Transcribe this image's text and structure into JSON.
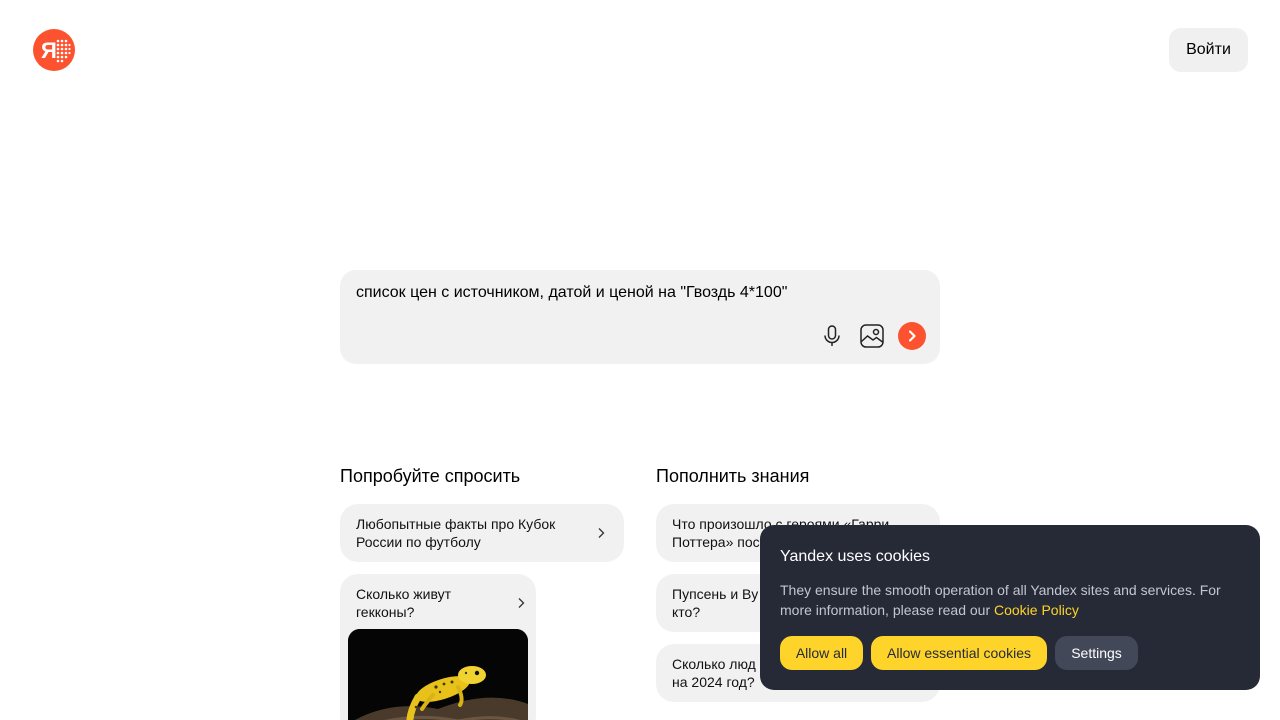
{
  "header": {
    "login_label": "Войти"
  },
  "search": {
    "query": "список цен с источником, датой и ценой на \"Гвоздь 4*100\""
  },
  "sections": {
    "try_asking": {
      "title": "Попробуйте спросить",
      "cards": [
        {
          "text": "Любопытные факты про Кубок России по футболу"
        },
        {
          "text": "Сколько живут гекконы?"
        }
      ]
    },
    "knowledge": {
      "title": "Пополнить знания",
      "cards": [
        {
          "text": "Что произошло с героями «Гарри Поттера» пос"
        },
        {
          "text": "Пупсень и Ву кто?"
        },
        {
          "text": "Сколько люд на 2024 год?"
        }
      ]
    }
  },
  "cookie_banner": {
    "title": "Yandex uses cookies",
    "description": "They ensure the smooth operation of all Yandex sites and services. For more information, please read our",
    "link_label": "Cookie Policy",
    "allow_all_label": "Allow all",
    "allow_essential_label": "Allow essential cookies",
    "settings_label": "Settings"
  },
  "colors": {
    "accent": "#fc5230",
    "cookie_bg": "#262a37",
    "cookie_button": "#fed42b",
    "card_bg": "#f1f1f1"
  }
}
